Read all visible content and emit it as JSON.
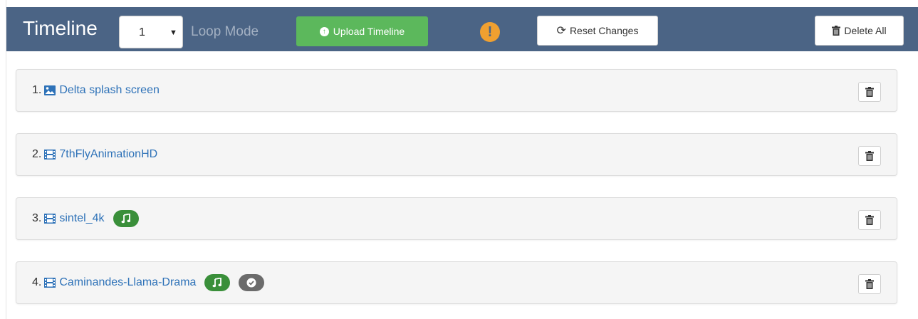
{
  "header": {
    "title": "Timeline",
    "timeline_select_value": "1",
    "loop_mode_label": "Loop Mode",
    "upload_button_label": "Upload Timeline",
    "warning_icon": "exclamation-icon",
    "reset_button_label": "Reset Changes",
    "delete_all_button_label": "Delete All"
  },
  "colors": {
    "header_bg": "#4b6485",
    "upload_green": "#5cb85c",
    "warning_orange": "#f0a030",
    "link_blue": "#2e72b8",
    "badge_green": "#3a8f3a",
    "badge_gray": "#6b6b6b"
  },
  "items": [
    {
      "index": "1.",
      "type_icon": "image-icon",
      "name": "Delta splash screen",
      "badges": []
    },
    {
      "index": "2.",
      "type_icon": "film-icon",
      "name": "7thFlyAnimationHD",
      "badges": []
    },
    {
      "index": "3.",
      "type_icon": "film-icon",
      "name": "sintel_4k",
      "badges": [
        "music-icon"
      ]
    },
    {
      "index": "4.",
      "type_icon": "film-icon",
      "name": "Caminandes-Llama-Drama",
      "badges": [
        "music-icon",
        "check-icon"
      ]
    }
  ]
}
